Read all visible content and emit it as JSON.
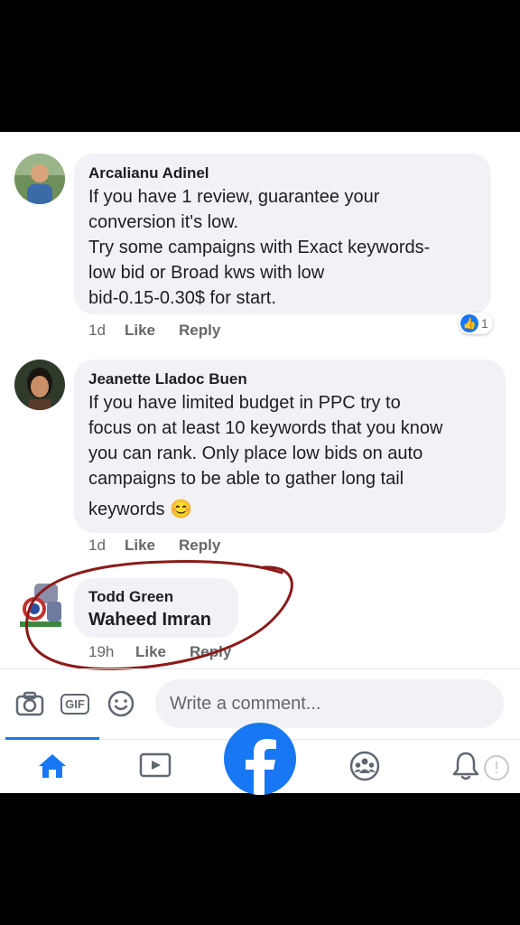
{
  "comments": [
    {
      "author": "Arcalianu Adinel",
      "lines": [
        "If you have 1 review, guarantee your",
        "conversion it's low.",
        "Try some campaigns with Exact keywords-",
        "low bid or Broad kws with low",
        "bid-0.15-0.30$ for start."
      ],
      "time": "1d",
      "like_label": "Like",
      "reply_label": "Reply",
      "reaction_count": "1"
    },
    {
      "author": "Jeanette Lladoc Buen",
      "lines": [
        "If you have limited budget in PPC try to",
        "focus on at least 10 keywords that you know",
        "you can rank. Only place low bids on auto",
        "campaigns to be able to gather long tail",
        "keywords 😊"
      ],
      "time": "1d",
      "like_label": "Like",
      "reply_label": "Reply"
    },
    {
      "author": "Todd Green",
      "tag": "Waheed Imran",
      "time": "19h",
      "like_label": "Like",
      "reply_label": "Reply"
    }
  ],
  "composer": {
    "placeholder": "Write a comment...",
    "gif_label": "GIF",
    "icons": [
      "camera-icon",
      "gif-icon",
      "emoji-icon"
    ]
  },
  "nav": {
    "active": "home",
    "icons": [
      "home-icon",
      "watch-icon",
      "facebook-logo",
      "groups-icon",
      "notifications-icon"
    ]
  },
  "colors": {
    "brand": "#1877f2",
    "bubble": "#f0f2f5",
    "annotation": "#8b1a1a"
  }
}
